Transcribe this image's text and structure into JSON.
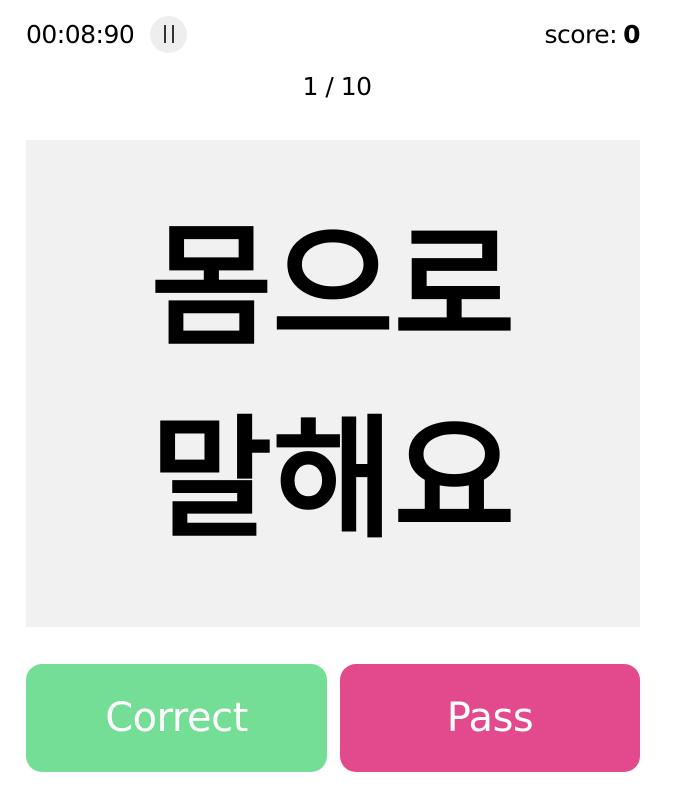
{
  "header": {
    "timer": "00:08:90",
    "pause_icon": "pause-icon",
    "score_label": "score:",
    "score_value": "0"
  },
  "progress": {
    "text": "1 / 10"
  },
  "card": {
    "word": "몸으로 말해요"
  },
  "actions": {
    "correct_label": "Correct",
    "pass_label": "Pass"
  },
  "colors": {
    "card_background": "#f1f1f1",
    "pause_button_background": "#eeeeee",
    "correct_button": "#74de97",
    "pass_button": "#e24a8d",
    "button_text": "#ffffff"
  }
}
